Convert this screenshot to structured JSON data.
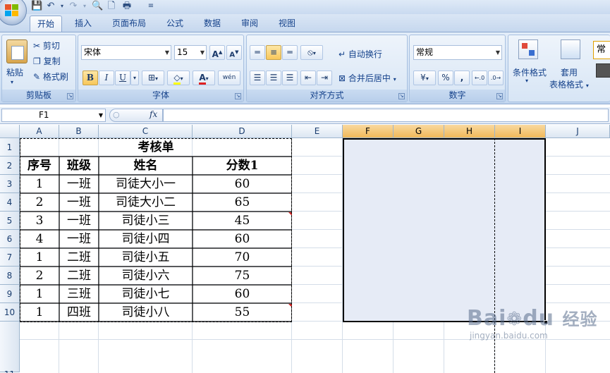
{
  "quick_access": {
    "icons": [
      "save-icon",
      "undo-icon",
      "redo-icon",
      "print-preview-icon",
      "new-icon",
      "quick-print-icon",
      "customize-icon"
    ]
  },
  "tabs": [
    {
      "label": "开始",
      "active": true
    },
    {
      "label": "插入",
      "active": false
    },
    {
      "label": "页面布局",
      "active": false
    },
    {
      "label": "公式",
      "active": false
    },
    {
      "label": "数据",
      "active": false
    },
    {
      "label": "审阅",
      "active": false
    },
    {
      "label": "视图",
      "active": false
    }
  ],
  "ribbon": {
    "clipboard": {
      "paste": "粘贴",
      "cut": "剪切",
      "copy": "复制",
      "format_painter": "格式刷",
      "label": "剪贴板"
    },
    "font": {
      "name": "宋体",
      "size": "15",
      "label": "字体",
      "bold": "B",
      "italic": "I",
      "underline": "U",
      "phonetic": "wén"
    },
    "alignment": {
      "wrap": "自动换行",
      "merge": "合并后居中",
      "label": "对齐方式"
    },
    "number": {
      "format": "常规",
      "percent": "%",
      "comma": ",",
      "label": "数字"
    },
    "styles": {
      "conditional": "条件格式",
      "table_format_1": "套用",
      "table_format_2": "表格格式",
      "cell_style": "常"
    }
  },
  "formula_bar": {
    "name_box": "F1",
    "fx": "fx",
    "value": ""
  },
  "columns": [
    "A",
    "B",
    "C",
    "D",
    "E",
    "F",
    "G",
    "H",
    "I",
    "J"
  ],
  "rows": [
    "1",
    "2",
    "3",
    "4",
    "5",
    "6",
    "7",
    "8",
    "9",
    "10",
    "11"
  ],
  "sheet": {
    "title": "考核单",
    "headers": [
      "序号",
      "班级",
      "姓名",
      "分数1"
    ],
    "data": [
      [
        "1",
        "一班",
        "司徒大小一",
        "60"
      ],
      [
        "2",
        "一班",
        "司徒大小二",
        "65"
      ],
      [
        "3",
        "一班",
        "司徒小三",
        "45"
      ],
      [
        "4",
        "一班",
        "司徒小四",
        "60"
      ],
      [
        "1",
        "二班",
        "司徒小五",
        "70"
      ],
      [
        "2",
        "二班",
        "司徒小六",
        "75"
      ],
      [
        "1",
        "三班",
        "司徒小七",
        "60"
      ],
      [
        "1",
        "四班",
        "司徒小八",
        "55"
      ]
    ]
  },
  "watermark": {
    "brand": "Bai",
    "brand2": "du",
    "suffix": "经验",
    "url": "jingyan.baidu.com"
  },
  "colors": {
    "ribbon": "#cfe0f4",
    "selection": "#e6ebf6",
    "accent": "#15428b"
  }
}
